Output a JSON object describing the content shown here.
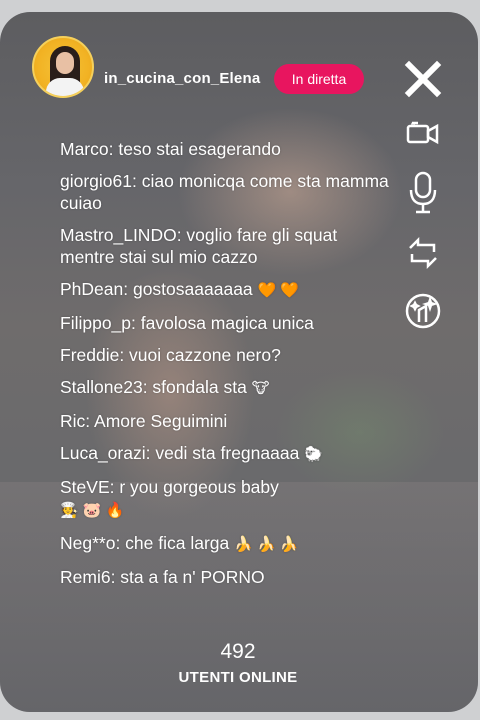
{
  "stream": {
    "username": "in_cucina_con_Elena",
    "live_label": "In diretta",
    "viewer_count": "492",
    "viewer_label": "UTENTI ONLINE"
  },
  "icons": {
    "close": "close-icon",
    "camera": "video-camera-icon",
    "mic": "microphone-icon",
    "switch_camera": "switch-camera-icon",
    "effects": "effects-wand-icon"
  },
  "colors": {
    "live_badge": "#e8155f",
    "text": "#ffffff"
  },
  "chat": [
    {
      "text": "Marco: teso stai esagerando",
      "emoji": ""
    },
    {
      "text": "giorgio61: ciao monicqa come sta mamma cuiao",
      "emoji": ""
    },
    {
      "text": "Mastro_LINDO: voglio fare gli squat mentre stai sul mio cazzo",
      "emoji": ""
    },
    {
      "text": "PhDean: gostosaaaaaaa",
      "emoji": "🧡 🧡"
    },
    {
      "text": "Filippo_p: favolosa magica unica",
      "emoji": ""
    },
    {
      "text": "Freddie: vuoi cazzone nero?",
      "emoji": ""
    },
    {
      "text": "Stallone23: sfondala sta",
      "emoji": "🐮"
    },
    {
      "text": "Ric: Amore Seguimini",
      "emoji": ""
    },
    {
      "text": "Luca_orazi: vedi sta fregnaaaa",
      "emoji": "🐑"
    },
    {
      "text": "SteVE: r you gorgeous baby",
      "emoji": "🧑‍🍳 🐷 🔥"
    },
    {
      "text": "Neg**o: che fica larga",
      "emoji": "🍌 🍌 🍌"
    },
    {
      "text": "Remi6: sta a fa n' PORNO",
      "emoji": ""
    }
  ]
}
